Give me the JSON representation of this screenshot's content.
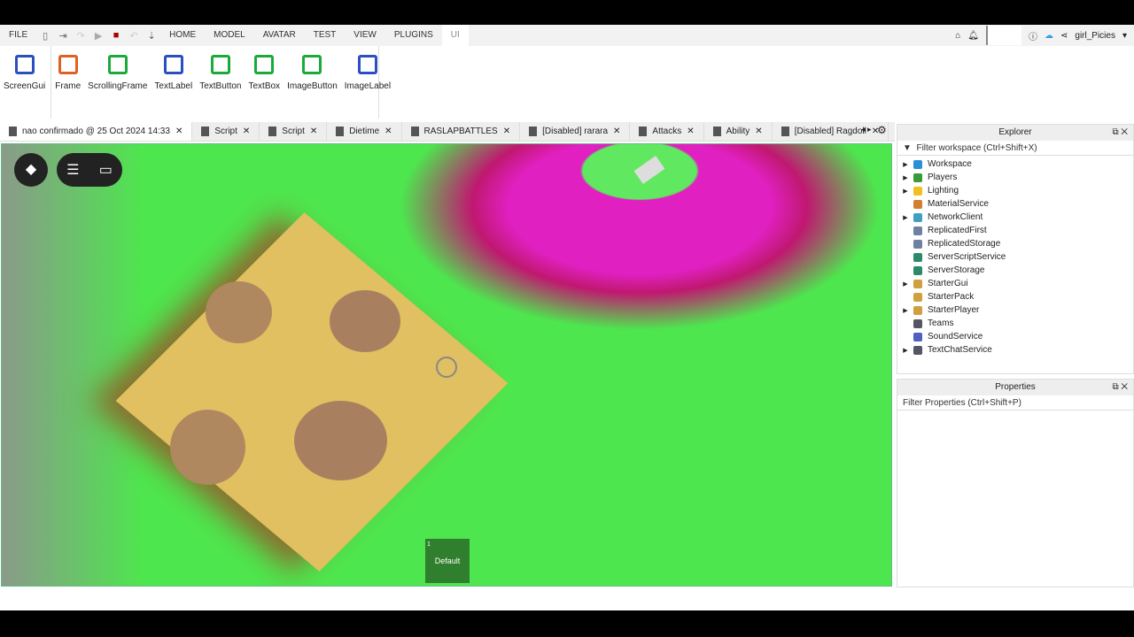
{
  "menu": {
    "file": "FILE",
    "tabs": [
      "HOME",
      "MODEL",
      "AVATAR",
      "TEST",
      "VIEW",
      "PLUGINS",
      "UI"
    ],
    "user": "girl_Picies"
  },
  "ribbon": [
    {
      "label": "ScreenGui",
      "color": "#2b4fbf"
    },
    {
      "label": "Frame",
      "color": "#e06020"
    },
    {
      "label": "ScrollingFrame",
      "color": "#1aaa3a"
    },
    {
      "label": "TextLabel",
      "color": "#2b4fbf"
    },
    {
      "label": "TextButton",
      "color": "#1aaa3a"
    },
    {
      "label": "TextBox",
      "color": "#1aaa3a"
    },
    {
      "label": "ImageButton",
      "color": "#1aaa3a"
    },
    {
      "label": "ImageLabel",
      "color": "#2b4fbf"
    }
  ],
  "tabs": [
    "nao confirmado @ 25 Oct 2024 14:33",
    "Script",
    "Script",
    "Dietime",
    "RASLAPBATTLES",
    "[Disabled] rarara",
    "Attacks",
    "Ability",
    "[Disabled] Ragdoll"
  ],
  "viewport": {
    "button_label": "Default",
    "button_index": "1"
  },
  "explorer": {
    "title": "Explorer",
    "filter": "Filter workspace (Ctrl+Shift+X)",
    "items": [
      {
        "label": "Workspace",
        "exp": true,
        "c": "#2a8fd8"
      },
      {
        "label": "Players",
        "exp": true,
        "c": "#3a9a3a"
      },
      {
        "label": "Lighting",
        "exp": true,
        "c": "#f0c020"
      },
      {
        "label": "MaterialService",
        "exp": false,
        "c": "#d08030"
      },
      {
        "label": "NetworkClient",
        "exp": true,
        "c": "#40a0c0"
      },
      {
        "label": "ReplicatedFirst",
        "exp": false,
        "c": "#7080a0"
      },
      {
        "label": "ReplicatedStorage",
        "exp": false,
        "c": "#7080a0"
      },
      {
        "label": "ServerScriptService",
        "exp": false,
        "c": "#2a8a6a"
      },
      {
        "label": "ServerStorage",
        "exp": false,
        "c": "#2a8a6a"
      },
      {
        "label": "StarterGui",
        "exp": true,
        "c": "#d0a040"
      },
      {
        "label": "StarterPack",
        "exp": false,
        "c": "#d0a040"
      },
      {
        "label": "StarterPlayer",
        "exp": true,
        "c": "#d0a040"
      },
      {
        "label": "Teams",
        "exp": false,
        "c": "#556"
      },
      {
        "label": "SoundService",
        "exp": false,
        "c": "#5060c0"
      },
      {
        "label": "TextChatService",
        "exp": true,
        "c": "#556"
      }
    ]
  },
  "properties": {
    "title": "Properties",
    "filter": "Filter Properties (Ctrl+Shift+P)"
  }
}
